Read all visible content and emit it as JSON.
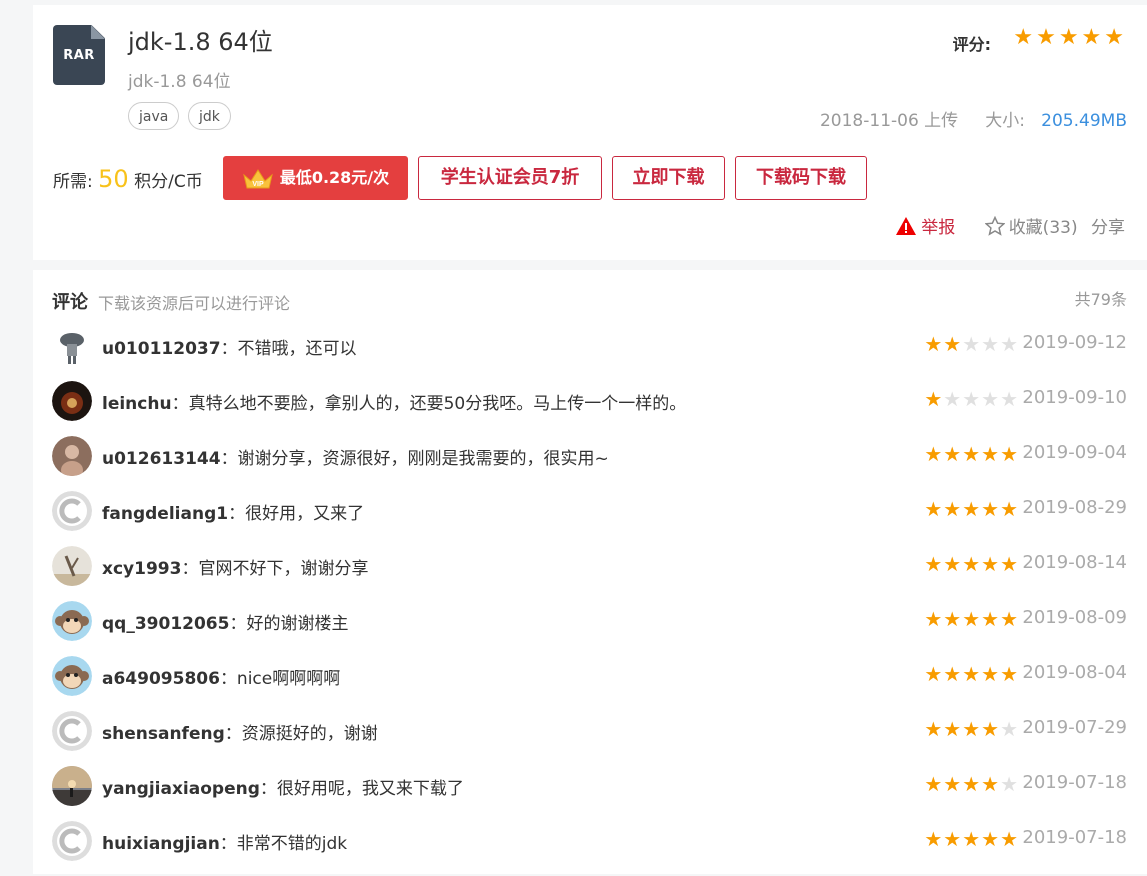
{
  "resource": {
    "file_type": "RAR",
    "title": "jdk-1.8 64位",
    "subtitle": "jdk-1.8 64位",
    "tags": [
      "java",
      "jdk"
    ],
    "rating_label": "评分:",
    "rating_stars": 5,
    "upload_text": "2018-11-06 上传",
    "size_label": "大小:",
    "size_value": "205.49MB",
    "price_prefix": "所需:",
    "price_value": "50",
    "price_suffix": "积分/C币",
    "buttons": {
      "vip": "最低0.28元/次",
      "student": "学生认证会员7折",
      "download": "立即下载",
      "code_download": "下载码下载"
    },
    "report_label": "举报",
    "collect_label": "收藏(33)",
    "share_label": "分享",
    "colors": {
      "accent": "#c9283f",
      "star": "#f89c00",
      "price": "#f8c21b",
      "link": "#3b8fde"
    }
  },
  "comments": {
    "title": "评论",
    "hint": "下载该资源后可以进行评论",
    "total": "共79条",
    "items": [
      {
        "user": "u010112037",
        "text": "：不错哦，还可以",
        "stars": 2,
        "date": "2019-09-12",
        "avatar": "figure"
      },
      {
        "user": "leinchu",
        "text": "：真特么地不要脸，拿别人的，还要50分我呸。马上传一个一样的。",
        "stars": 1,
        "date": "2019-09-10",
        "avatar": "dark"
      },
      {
        "user": "u012613144",
        "text": "：谢谢分享，资源很好，刚刚是我需要的，很实用~",
        "stars": 5,
        "date": "2019-09-04",
        "avatar": "brown"
      },
      {
        "user": "fangdeliang1",
        "text": "：很好用，又来了",
        "stars": 5,
        "date": "2019-08-29",
        "avatar": "default"
      },
      {
        "user": "xcy1993",
        "text": "：官网不好下，谢谢分享",
        "stars": 5,
        "date": "2019-08-14",
        "avatar": "photo"
      },
      {
        "user": "qq_39012065",
        "text": "：好的谢谢楼主",
        "stars": 5,
        "date": "2019-08-09",
        "avatar": "monkey"
      },
      {
        "user": "a649095806",
        "text": "：nice啊啊啊啊",
        "stars": 5,
        "date": "2019-08-04",
        "avatar": "monkey"
      },
      {
        "user": "shensanfeng",
        "text": "：资源挺好的，谢谢",
        "stars": 4,
        "date": "2019-07-29",
        "avatar": "default"
      },
      {
        "user": "yangjiaxiaopeng",
        "text": "：很好用呢，我又来下载了",
        "stars": 4,
        "date": "2019-07-18",
        "avatar": "sunset"
      },
      {
        "user": "huixiangjian",
        "text": "：非常不错的jdk",
        "stars": 5,
        "date": "2019-07-18",
        "avatar": "default"
      }
    ]
  }
}
